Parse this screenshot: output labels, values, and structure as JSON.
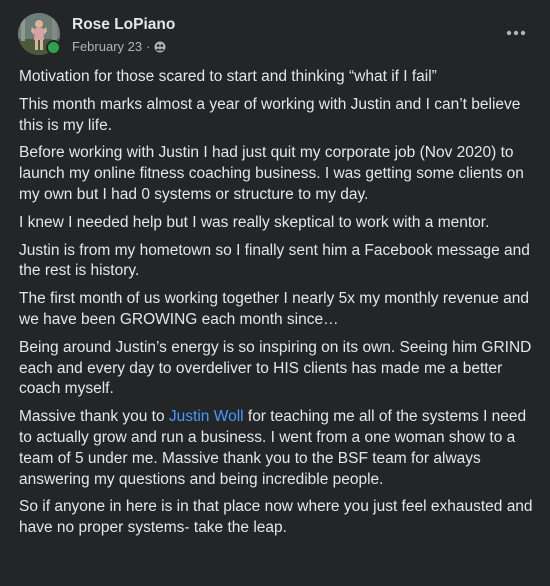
{
  "post": {
    "author": "Rose LoPiano",
    "date": "February 23",
    "separator": "·",
    "privacy_icon": "group-members-icon",
    "more_icon": "more-options-icon",
    "paragraphs": [
      {
        "text": "Motivation for those scared to start and thinking “what if I fail”"
      },
      {
        "text": "This month marks almost a year of working with Justin and I can’t believe this is my life."
      },
      {
        "text": "Before working with Justin I had just quit my corporate job (Nov 2020) to launch my online fitness coaching business. I was getting some clients on my own but I had 0 systems or structure to my day."
      },
      {
        "text": "I knew I needed help but I was really skeptical to work with a mentor."
      },
      {
        "text": "Justin is from my hometown so I finally sent him a Facebook message and the rest is history."
      },
      {
        "text": "The first month of us working together I nearly 5x my monthly revenue and we have been GROWING each month since…"
      },
      {
        "text": "Being around Justin’s energy is so inspiring on its own. Seeing him GRIND each and every day to overdeliver to HIS clients has made me a better coach myself."
      },
      {
        "before": "Massive thank you to ",
        "mention": "Justin Woll",
        "after": " for teaching me all of the systems I need to actually grow and run a business. I went from a one woman show to a team of 5 under me. Massive thank you to the BSF team for always answering my questions and being incredible people."
      },
      {
        "text": "So if anyone in here is in that place now where you just feel exhausted and have no proper systems- take the leap."
      }
    ]
  },
  "colors": {
    "background": "#242526",
    "primary_text": "#e4e6eb",
    "secondary_text": "#b0b3b8",
    "mention": "#4599ff",
    "online": "#31a24c"
  }
}
